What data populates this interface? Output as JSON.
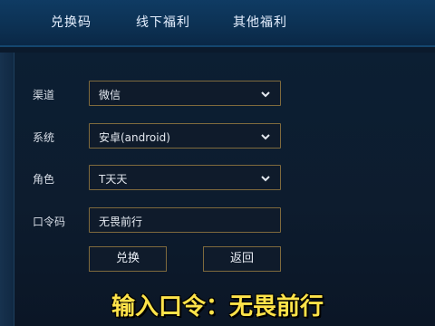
{
  "top_tabs": [
    "兑换码",
    "线下福利",
    "其他福利"
  ],
  "form": {
    "channel_label": "渠道",
    "channel_value": "微信",
    "system_label": "系统",
    "system_value": "安卓(android)",
    "role_label": "角色",
    "role_value": "T天天",
    "code_label": "口令码",
    "code_value": "无畏前行"
  },
  "buttons": {
    "redeem": "兑换",
    "back": "返回"
  },
  "caption": "输入口令：无畏前行",
  "colors": {
    "field_border": "#7f6a3d",
    "caption": "#ffe34a"
  }
}
